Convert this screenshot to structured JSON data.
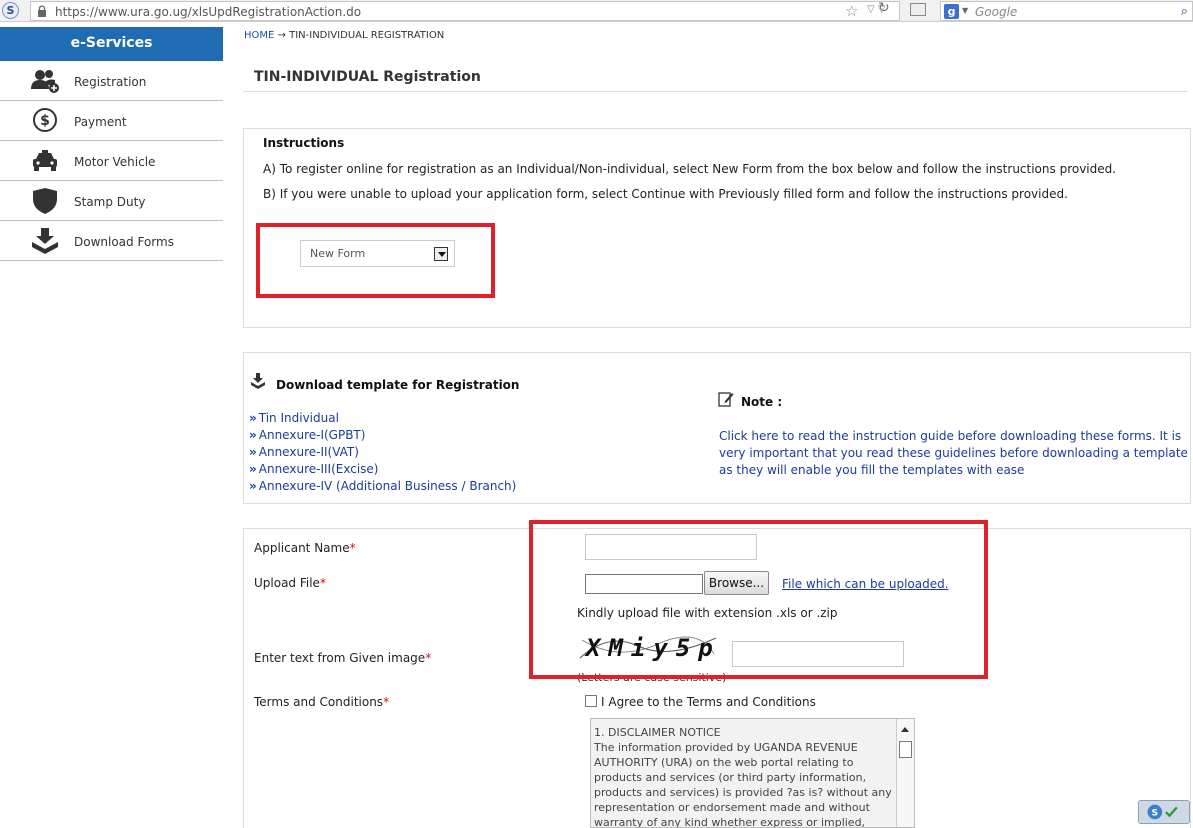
{
  "browser": {
    "url": "https://www.ura.go.ug/xlsUpdRegistrationAction.do",
    "search_placeholder": "Google"
  },
  "sidebar": {
    "header": "e-Services",
    "items": [
      {
        "label": "Registration",
        "icon": "user-group-icon"
      },
      {
        "label": "Payment",
        "icon": "dollar-coin-icon"
      },
      {
        "label": "Motor Vehicle",
        "icon": "car-icon"
      },
      {
        "label": "Stamp Duty",
        "icon": "shield-icon"
      },
      {
        "label": "Download Forms",
        "icon": "download-box-icon"
      }
    ]
  },
  "breadcrumb": {
    "home": "HOME",
    "separator": "→",
    "current": "TIN-INDIVIDUAL REGISTRATION"
  },
  "page": {
    "title": "TIN-INDIVIDUAL Registration"
  },
  "instructions": {
    "title": "Instructions",
    "line_a": "A) To register online for registration as an Individual/Non-individual, select New Form from the box below and follow the instructions provided.",
    "line_b": "B) If you were unable to upload your application form, select Continue with Previously filled form and follow the instructions provided.",
    "selected_form": "New Form"
  },
  "download": {
    "title": "Download template for Registration",
    "links": [
      "Tin Individual",
      "Annexure-I(GPBT)",
      "Annexure-II(VAT)",
      "Annexure-III(Excise)",
      "Annexure-IV (Additional Business / Branch)"
    ],
    "note_label": "Note :",
    "note_text": "Click here to read the instruction guide before downloading these forms. It is very important that you read these guidelines before downloading a template as they will enable you fill the templates with ease"
  },
  "form": {
    "applicant_name_label": "Applicant Name",
    "upload_label": "Upload File",
    "browse_label": "Browse...",
    "upload_link": "File which can be uploaded.",
    "upload_hint": "Kindly upload file with extension .xls or .zip",
    "captcha_label": "Enter text from Given image",
    "captcha_text": "XMiy5p",
    "captcha_note": "(Letters are case sensitive)",
    "terms_label": "Terms and Conditions",
    "agree_label": "I Agree to the Terms and Conditions",
    "required_mark": "*",
    "terms_text": "1. DISCLAIMER  NOTICE\n The information provided by UGANDA REVENUE AUTHORITY (URA) on the web portal relating to products and services (or third party information, products and services) is provided ?as is? without any representation or endorsement made and without warranty of any kind whether express or implied, including but not limited to the"
  },
  "colors": {
    "accent": "#1f6cb3",
    "highlight": "#e0202a",
    "link": "#1a3d9c"
  }
}
